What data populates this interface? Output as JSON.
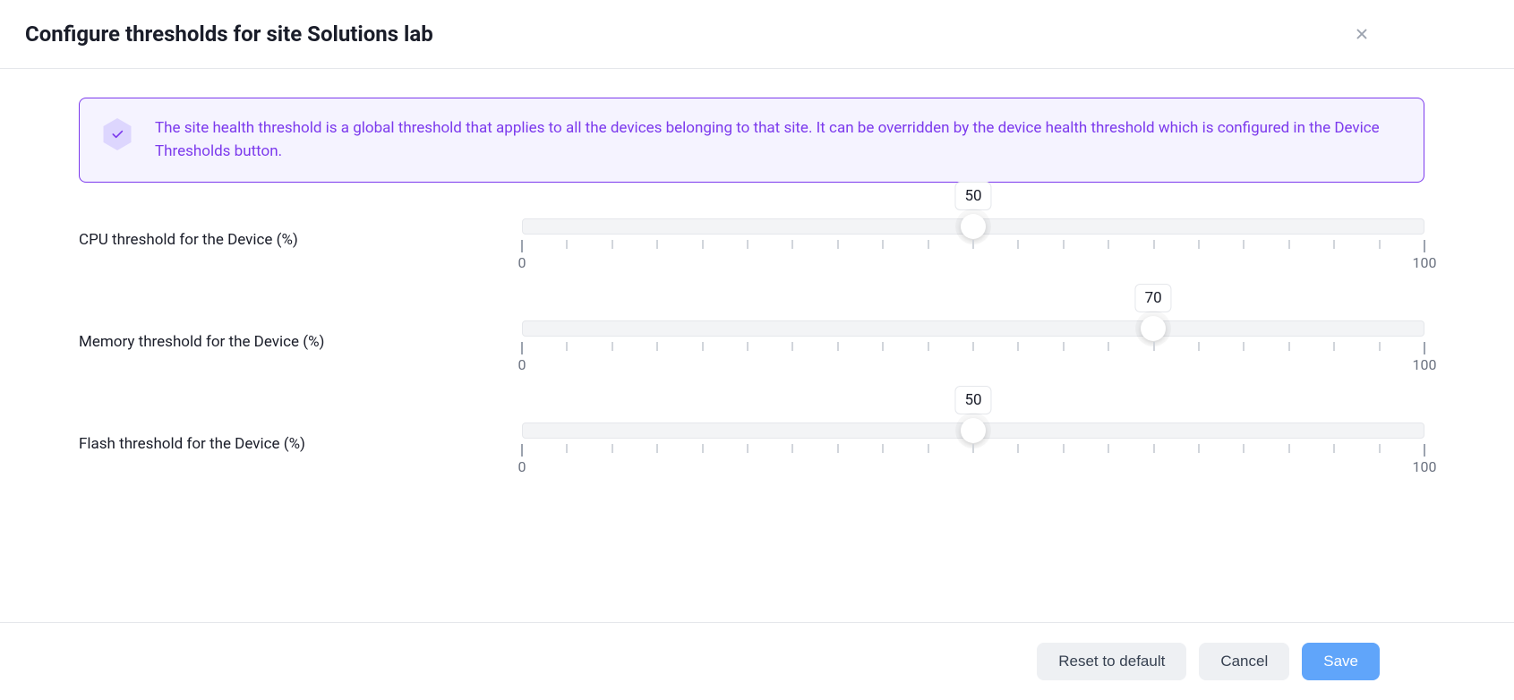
{
  "header": {
    "title": "Configure thresholds for site Solutions lab"
  },
  "info": {
    "text": "The site health threshold is a global threshold that applies to all the devices belonging to that site. It can be overridden by the device health threshold which is configured in the Device Thresholds button."
  },
  "sliders": {
    "cpu": {
      "label": "CPU threshold for the Device (%)",
      "value": 50,
      "min": 0,
      "max": 100,
      "minLabel": "0",
      "maxLabel": "100"
    },
    "memory": {
      "label": "Memory threshold for the Device (%)",
      "value": 70,
      "min": 0,
      "max": 100,
      "minLabel": "0",
      "maxLabel": "100"
    },
    "flash": {
      "label": "Flash threshold for the Device (%)",
      "value": 50,
      "min": 0,
      "max": 100,
      "minLabel": "0",
      "maxLabel": "100"
    }
  },
  "buttons": {
    "reset": "Reset to default",
    "cancel": "Cancel",
    "save": "Save"
  }
}
